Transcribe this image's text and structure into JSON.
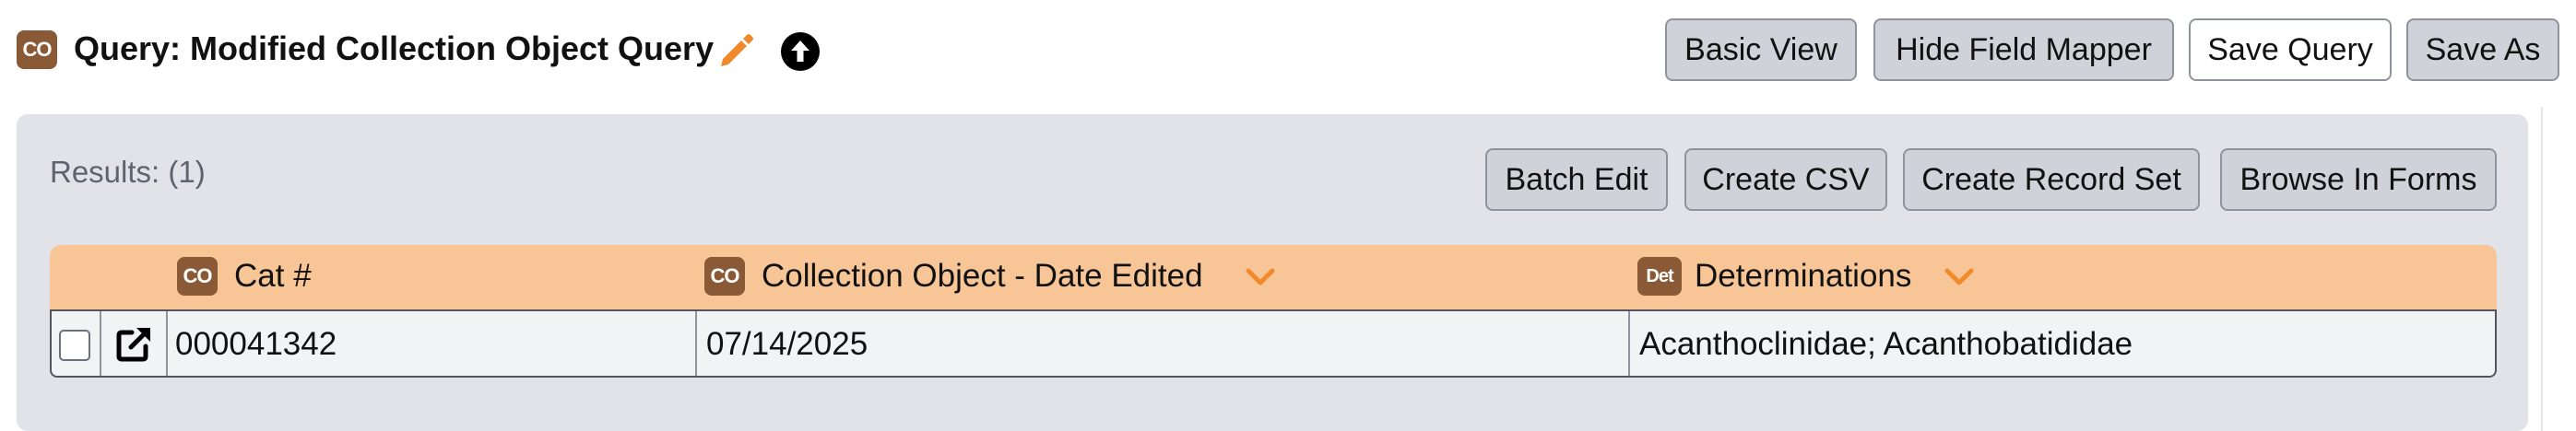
{
  "header": {
    "table_badge": "CO",
    "title": "Query: Modified Collection Object Query",
    "edit_icon": "pencil-icon",
    "up_icon": "circle-arrow-up-icon",
    "buttons": {
      "basic_view": "Basic View",
      "hide_field_mapper": "Hide Field Mapper",
      "save_query": "Save Query",
      "save_as": "Save As"
    }
  },
  "results": {
    "label": "Results: (1)",
    "buttons": {
      "batch_edit": "Batch Edit",
      "create_csv": "Create CSV",
      "create_record_set": "Create Record Set",
      "browse_in_forms": "Browse In Forms"
    }
  },
  "table": {
    "columns": [
      {
        "badge": "CO",
        "label": "Cat #"
      },
      {
        "badge": "CO",
        "label": "Collection Object - Date Edited"
      },
      {
        "badge": "Det",
        "label": "Determinations"
      }
    ],
    "rows": [
      {
        "cat_number": "000041342",
        "date_edited": "07/14/2025",
        "determinations": "Acanthoclinidae; Acanthobatididae"
      }
    ]
  },
  "colors": {
    "badge": "#8a5a36",
    "accent_orange": "#f08a2c",
    "header_row": "#f8c696",
    "panel": "#e2e3e8",
    "button": "#cfd2d8"
  }
}
